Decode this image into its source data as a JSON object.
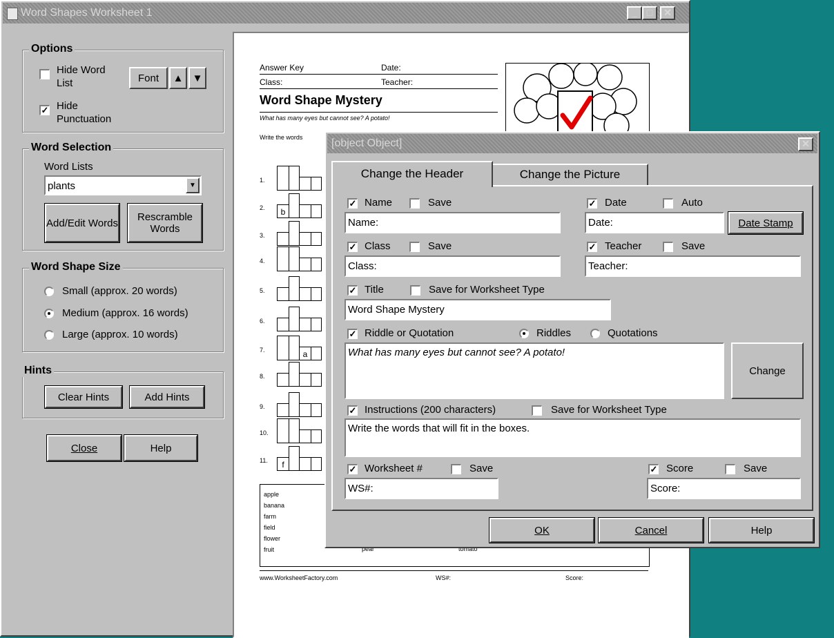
{
  "main_window": {
    "title": "Word Shapes Worksheet 1",
    "options": {
      "legend": "Options",
      "hide_word_list": {
        "label": "Hide Word List",
        "checked": false
      },
      "hide_punctuation": {
        "label": "Hide Punctuation",
        "checked": true
      },
      "font_button": "Font"
    },
    "word_selection": {
      "legend": "Word Selection",
      "word_lists_label": "Word Lists",
      "selected_list": "plants",
      "add_edit_button": "Add/Edit Words",
      "rescramble_button": "Rescramble Words"
    },
    "word_shape_size": {
      "legend": "Word Shape Size",
      "options": [
        {
          "label": "Small (approx. 20 words)",
          "selected": false
        },
        {
          "label": "Medium (approx. 16 words)",
          "selected": true
        },
        {
          "label": "Large (approx. 10 words)",
          "selected": false
        }
      ]
    },
    "hints": {
      "legend": "Hints",
      "clear_button": "Clear Hints",
      "add_button": "Add Hints"
    },
    "close_button": "Close",
    "help_button": "Help"
  },
  "worksheet": {
    "answer_key": "Answer Key",
    "date": "Date:",
    "class": "Class:",
    "teacher": "Teacher:",
    "title": "Word Shape Mystery",
    "riddle": "What has many eyes but cannot see? A potato!",
    "instructions_visible": "Write the words",
    "row_numbers": [
      "1.",
      "2.",
      "3.",
      "4.",
      "5.",
      "6.",
      "7.",
      "8.",
      "9.",
      "10.",
      "11."
    ],
    "hint_letters": {
      "row2": "b",
      "row7": "a",
      "row11": "f"
    },
    "word_list_col1": [
      "apple",
      "banana",
      "farm",
      "field",
      "flower",
      "fruit"
    ],
    "word_list_col2_visible": "pear",
    "word_list_col3_visible": "tomato",
    "footer_url": "www.WorksheetFactory.com",
    "footer_ws": "WS#:",
    "footer_score": "Score:"
  },
  "dialog": {
    "title": {
      "label": "Title",
      "checked": true,
      "save_label": "Save for Worksheet Type",
      "save_checked": false,
      "value": "Word Shape Mystery"
    },
    "tabs": [
      {
        "label": "Change the Header",
        "active": true
      },
      {
        "label": "Change the Picture",
        "active": false
      }
    ],
    "name": {
      "label": "Name",
      "checked": true,
      "save_label": "Save",
      "save_checked": false,
      "value": "Name:"
    },
    "date": {
      "label": "Date",
      "checked": true,
      "auto_label": "Auto",
      "auto_checked": false,
      "value": "Date:",
      "stamp_button": "Date Stamp"
    },
    "class": {
      "label": "Class",
      "checked": true,
      "save_label": "Save",
      "save_checked": false,
      "value": "Class:"
    },
    "teacher": {
      "label": "Teacher",
      "checked": true,
      "save_label": "Save",
      "save_checked": false,
      "value": "Teacher:"
    },
    "riddle": {
      "label": "Riddle or Quotation",
      "checked": true,
      "riddles_label": "Riddles",
      "riddles_selected": true,
      "quotations_label": "Quotations",
      "quotations_selected": false,
      "value": "What has many eyes but cannot see? A potato!",
      "change_button": "Change"
    },
    "instructions": {
      "label": "Instructions (200 characters)",
      "checked": true,
      "save_label": "Save for Worksheet Type",
      "save_checked": false,
      "value": "Write the words that will fit in the boxes."
    },
    "worksheet_num": {
      "label": "Worksheet #",
      "checked": true,
      "save_label": "Save",
      "save_checked": false,
      "value": "WS#:"
    },
    "score": {
      "label": "Score",
      "checked": true,
      "save_label": "Save",
      "save_checked": false,
      "value": "Score:"
    },
    "ok_button": "OK",
    "cancel_button": "Cancel",
    "help_button": "Help"
  },
  "colors": {
    "desktop": "#108080",
    "face": "#c0c0c0",
    "check_red": "#e00000"
  }
}
